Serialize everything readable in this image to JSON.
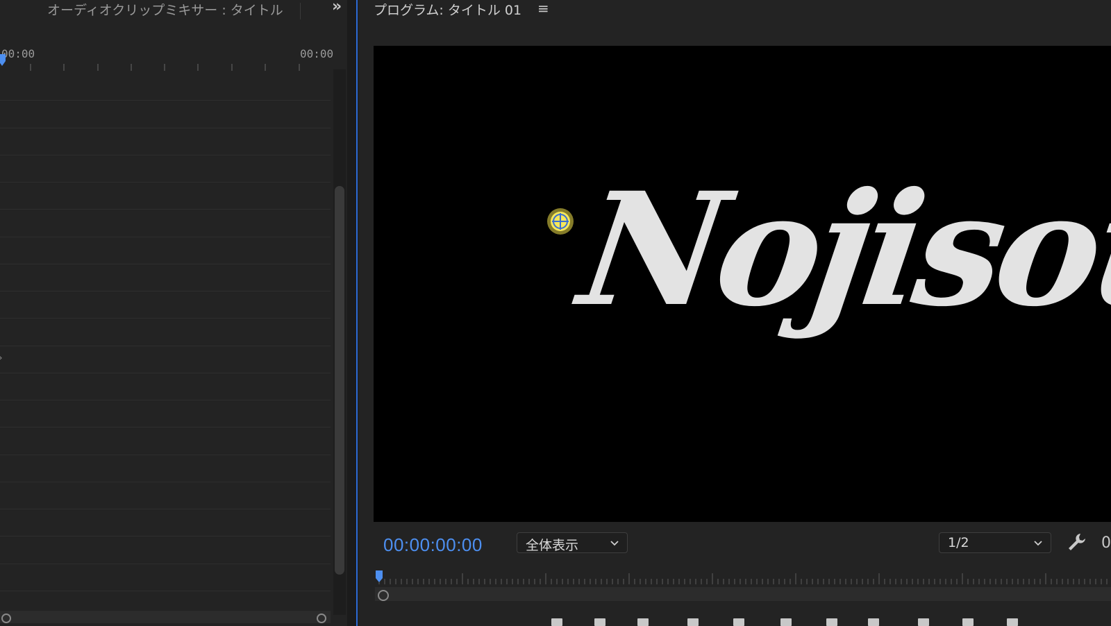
{
  "left_panel": {
    "tab_title": "オーディオクリップミキサー : タイトル",
    "overflow_icon": "»",
    "timecode_start": "00:00",
    "timecode_end": "00:00"
  },
  "program_monitor": {
    "title": "プログラム: タイトル 01",
    "menu_icon": "≡",
    "title_text": "Nojisou",
    "timecode": "00:00:00:00",
    "zoom_label": "全体表示",
    "resolution_label": "1/2",
    "clipped_right_text": "0"
  },
  "colors": {
    "accent_blue": "#4d8ff0",
    "panel_bg": "#232323",
    "video_bg": "#000000",
    "anchor_yellow": "#f2e24a"
  },
  "icons": {
    "overflow": "double-chevron-right-icon",
    "panel_menu": "hamburger-menu-icon",
    "settings": "wrench-icon",
    "anchor": "crosshair-anchor-icon",
    "dropdown": "chevron-down-icon"
  },
  "transport_controls": [
    {
      "name": "mark-in-icon"
    },
    {
      "name": "mark-out-icon"
    },
    {
      "name": "go-to-in-icon"
    },
    {
      "name": "step-back-icon"
    },
    {
      "name": "play-icon"
    },
    {
      "name": "step-forward-icon"
    },
    {
      "name": "go-to-out-icon"
    },
    {
      "name": "lift-icon"
    },
    {
      "name": "extract-icon"
    },
    {
      "name": "export-frame-icon"
    },
    {
      "name": "comparison-view-icon"
    }
  ]
}
